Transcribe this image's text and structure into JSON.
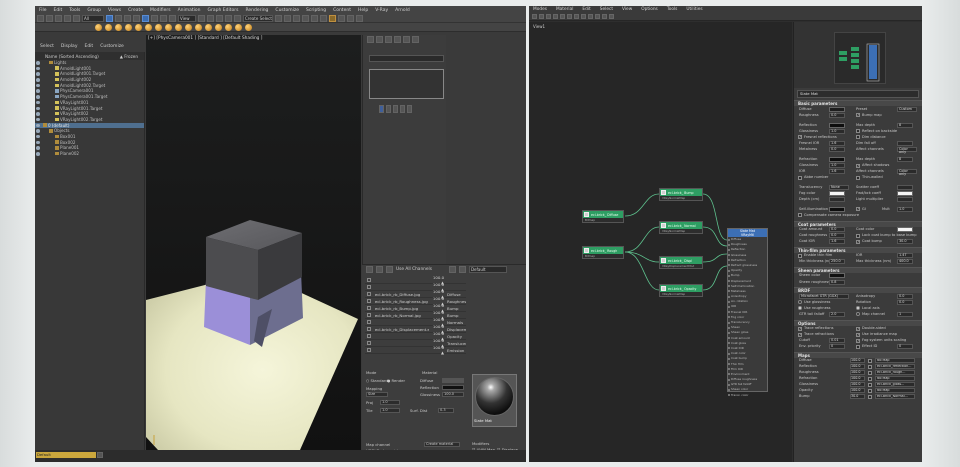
{
  "max": {
    "menu": [
      "File",
      "Edit",
      "Tools",
      "Group",
      "Views",
      "Create",
      "Modifiers",
      "Animation",
      "Graph Editors",
      "Rendering",
      "Customize",
      "Scripting",
      "Content",
      "Help",
      "V-Ray",
      "Arnold"
    ],
    "workspace_label": "Default",
    "explorer": {
      "tabs": [
        "Select",
        "Display",
        "Edit",
        "Customize"
      ],
      "col_name": "Name (Sorted Ascending)",
      "col_frozen": "▲ Frozen",
      "rows": [
        {
          "label": "Lights",
          "indent": 1,
          "kind": "group",
          "sel": false
        },
        {
          "label": "ArnoldLight001",
          "indent": 2,
          "kind": "light",
          "sel": false
        },
        {
          "label": "ArnoldLight001.Target",
          "indent": 2,
          "kind": "light",
          "sel": false
        },
        {
          "label": "ArnoldLight002",
          "indent": 2,
          "kind": "light",
          "sel": false
        },
        {
          "label": "ArnoldLight002.Target",
          "indent": 2,
          "kind": "light",
          "sel": false
        },
        {
          "label": "PhysCamera001",
          "indent": 2,
          "kind": "cam",
          "sel": false
        },
        {
          "label": "PhysCamera001.Target",
          "indent": 2,
          "kind": "cam",
          "sel": false
        },
        {
          "label": "VRayLight001",
          "indent": 2,
          "kind": "light",
          "sel": false
        },
        {
          "label": "VRayLight001.Target",
          "indent": 2,
          "kind": "light",
          "sel": false
        },
        {
          "label": "VRayLight002",
          "indent": 2,
          "kind": "light",
          "sel": false
        },
        {
          "label": "VRayLight002.Target",
          "indent": 2,
          "kind": "light",
          "sel": false
        },
        {
          "label": "0 (default)",
          "indent": 0,
          "kind": "layer",
          "sel": true
        },
        {
          "label": "Objects",
          "indent": 1,
          "kind": "group",
          "sel": false
        },
        {
          "label": "Box001",
          "indent": 2,
          "kind": "obj",
          "sel": false
        },
        {
          "label": "Box002",
          "indent": 2,
          "kind": "obj",
          "sel": false
        },
        {
          "label": "Plane001",
          "indent": 2,
          "kind": "obj",
          "sel": false
        },
        {
          "label": "Plane002",
          "indent": 2,
          "kind": "obj",
          "sel": false
        }
      ]
    },
    "viewport_label": "[+] [PhysCamera001 ] [Standard ] [Default Shading ]",
    "status_selection": "Default",
    "material_panel": {
      "title": "Use All Channels",
      "preset": "Default",
      "rows": [
        {
          "name": "",
          "pct": "100.0 ▲",
          "ch": ""
        },
        {
          "name": "",
          "pct": "100.0 ▲",
          "ch": ""
        },
        {
          "name": "ecl-brick_rb_Diffuse.jpg",
          "pct": "100.0 ▲",
          "ch": "Diffuse"
        },
        {
          "name": "ecl-brick_rb_Roughness.jpg",
          "pct": "100.0 ▲",
          "ch": "Roughness"
        },
        {
          "name": "ecl-brick_rb_Bump.jpg",
          "pct": "100.0 ▲",
          "ch": "Bump"
        },
        {
          "name": "ecl-brick_rb_Normal.jpg",
          "pct": "100.0 ▲",
          "ch": "Bump"
        },
        {
          "name": "",
          "pct": "100.0 ▲",
          "ch": "Normals"
        },
        {
          "name": "ecl-brick_rb_Displacement.exr",
          "pct": "100.0 ▲",
          "ch": "Displacement"
        },
        {
          "name": "",
          "pct": "100.0 ▲",
          "ch": "Opacity"
        },
        {
          "name": "",
          "pct": "100.0 ▲",
          "ch": "Translucency"
        },
        {
          "name": "",
          "pct": "100.0 ▲",
          "ch": "Emission"
        }
      ],
      "labels": {
        "mode": "Mode",
        "standard": "Standard",
        "render": "Render",
        "material": "Material",
        "diffuse": "Diffuse",
        "reflection": "Reflection",
        "glossiness": "Glossiness",
        "gloss_val": "100.0",
        "mapping": "Mapping",
        "proj": "Proj",
        "size": "Size",
        "size_val": "1.0",
        "tile": "Tile",
        "tile_val": "1.0",
        "surf": "Surf. Dist",
        "surf_val": "0.3",
        "map_channel": "Map channel",
        "hdr": "HDRI Texture aid",
        "link": "Link parameters",
        "create": "Create material",
        "update": "Update",
        "close": "Close",
        "modifiers": "Modifiers",
        "uvwmap": "UVW Map",
        "displace": "Displace",
        "disp_val": "100.0",
        "s2": "3.775 ▲",
        "sl": "Slot",
        "mat_slot": "Material slot",
        "slot_name": "Slate Mat"
      }
    }
  },
  "slate": {
    "menu": [
      "Modes",
      "Material",
      "Edit",
      "Select",
      "View",
      "Options",
      "Tools",
      "Utilities"
    ],
    "view_label": "View1",
    "nodes_left": [
      {
        "title": "ecl-brick_ Diffuse",
        "sub": "Bitmap"
      },
      {
        "title": "ecl-brick_ Rough",
        "sub": "Bitmap"
      }
    ],
    "nodes_mid": [
      {
        "title": "ecl-brick_ Bump",
        "sub": "VRayNormalMap"
      },
      {
        "title": "ecl-brick_ Normal",
        "sub": "VRayNormalMap"
      },
      {
        "title": "ecl-brick_ Displ",
        "sub": "VRayDisplacementMod"
      },
      {
        "title": "ecl-brick_ Opacity",
        "sub": "VRayNormalMap"
      }
    ],
    "main_node": {
      "title": "Slate Mat",
      "sub": "VRayMtl",
      "slots": [
        "Diffuse",
        "Roughness",
        "Reflection",
        "Glossiness",
        "Refraction",
        "Refract glossiness",
        "Opacity",
        "Bump",
        "Displacement",
        "Self-illumination",
        "Metalness",
        "Anisotropy",
        "An. rotation",
        "IOR",
        "Fresnel IOR",
        "Fog color",
        "Translucency",
        "Sheen",
        "Sheen gloss",
        "Coat amount",
        "Coat gloss",
        "Coat IOR",
        "Coat color",
        "Coat bump",
        "Thin film",
        "Film IOR",
        "Environment",
        "Diffuse roughness",
        "GTR tail falloff",
        "Sheen color",
        "Transl. color"
      ]
    },
    "params": {
      "material_name": "Slate Mat",
      "basic": "Basic parameters",
      "diffuse": "Diffuse",
      "preset": "Preset",
      "preset_val": "Custom",
      "roughness": "Roughness",
      "roughness_val": "0.0",
      "bump_map": "Bump map",
      "reflection": "Reflection",
      "max_depth": "Max depth",
      "max_depth_val": "8",
      "glossiness": "Glossiness",
      "gloss_val": "1.0",
      "reflect_back": "Reflect on backside",
      "fresnel": "Fresnel reflections",
      "dim_dist": "Dim distance",
      "fresnel_ior": "Fresnel IOR",
      "fresnel_ior_val": "1.6",
      "fresnel_ior_b": "L",
      "dim_falloff": "Dim fall off",
      "metalness": "Metalness",
      "metalness_val": "0.0",
      "affect_ch": "Affect channels",
      "affect_ch_val": "Color only",
      "refraction": "Refraction",
      "glossiness2": "Glossiness",
      "glossiness2_val": "1.0",
      "affect_shadows": "Affect shadows",
      "ior": "IOR",
      "ior_val": "1.6",
      "affect_ch2_val": "Color only",
      "abbe": "Abbe number",
      "thin": "Thin-walled",
      "translucency": "Translucency",
      "transl_val": "None",
      "fog_color": "Fog color",
      "scatter_coeff": "Scatter coeff",
      "depth": "Depth (cm)",
      "fwd_bwd": "Fwd/bck coeff",
      "light_mult": "Light multiplier",
      "self_illum": "Self-illumination",
      "gi": "GI",
      "mult": "Mult",
      "mult_val": "1.0",
      "comp_cam": "Compensate camera exposure",
      "coat": "Coat parameters",
      "coat_amount": "Coat amount",
      "coat_amount_val": "0.0",
      "coat_color": "Coat color",
      "coat_rough": "Coat roughness",
      "coat_rough_val": "0.0",
      "lock_coat": "Lock coat bump to base bump",
      "coat_ior": "Coat IOR",
      "coat_ior_val": "1.6",
      "coat_bump": "Coat bump",
      "coat_bump_val": "30.0",
      "film": "Thin-film parameters",
      "enable_film": "Enable thin film",
      "film_ior": "IOR",
      "film_ior_val": "1.47",
      "min_thick": "Min thickness (nm)",
      "min_thick_val": "250.0",
      "max_thick": "Max thickness (nm)",
      "max_thick_val": "400.0",
      "sheen": "Sheen parameters",
      "sheen_color": "Sheen color",
      "sheen_gloss": "Sheen roughness",
      "sheen_gloss_val": "0.8",
      "brdf": "BRDF",
      "brdf_type": "Microfacet GTR (GGX)",
      "anisotropy": "Anisotropy",
      "aniso_val": "0.0",
      "use_gloss": "Use glossiness",
      "rotation": "Rotation",
      "rot_val": "0.0",
      "use_rough": "Use roughness",
      "local_axis": "Local axis",
      "gtr": "GTR tail falloff",
      "gtr_val": "2.0",
      "map_channel": "Map channel",
      "map_channel_val": "1",
      "options": "Options",
      "trace_refl": "Trace reflections",
      "double": "Double-sided",
      "trace_refr": "Trace refractions",
      "use_irr": "Use irradiance map",
      "cutoff": "Cutoff",
      "cutoff_val": "0.01",
      "fog_sys": "Fog system units scaling",
      "env_pri": "Env. priority",
      "env_pri_val": "0",
      "effect_id": "Effect ID",
      "effect_id_val": "0",
      "maps": "Maps",
      "map_rows": [
        {
          "label": "Diffuse",
          "val": "100.0",
          "map": "No Map"
        },
        {
          "label": "Reflection",
          "val": "100.0",
          "map": "ecl-brick_reflection..."
        },
        {
          "label": "Roughness",
          "val": "100.0",
          "map": "ecl-brick_rough..."
        },
        {
          "label": "Refraction",
          "val": "100.0",
          "map": "No Map"
        },
        {
          "label": "Glossiness",
          "val": "100.0",
          "map": "ecl-brick_gloss..."
        },
        {
          "label": "Opacity",
          "val": "100.0",
          "map": "No Map"
        },
        {
          "label": "Bump",
          "val": "30.0",
          "map": "ecl-brick_Normal..."
        }
      ]
    }
  },
  "colors": {
    "accent_blue": "#3c6fb5",
    "node_green": "#2e9e63",
    "wire_green": "#5ec28e",
    "selection_yellow": "#caa63c"
  }
}
